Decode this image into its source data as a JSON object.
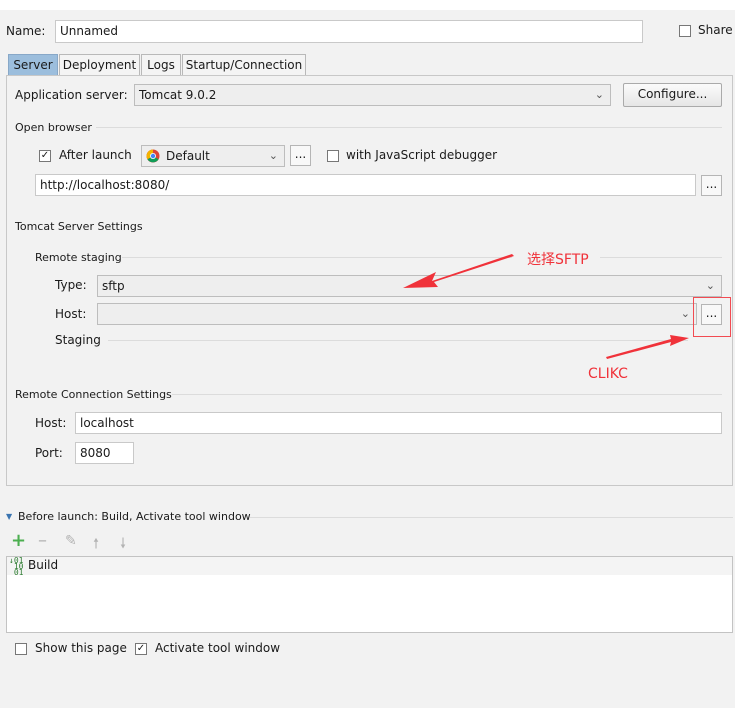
{
  "name": {
    "label": "Name:",
    "value": "Unnamed"
  },
  "share": {
    "label": "Share",
    "checked": false
  },
  "tabs": [
    {
      "label": "Server",
      "active": true
    },
    {
      "label": "Deployment",
      "active": false
    },
    {
      "label": "Logs",
      "active": false
    },
    {
      "label": "Startup/Connection",
      "active": false
    }
  ],
  "app_server": {
    "label": "Application server:",
    "value": "Tomcat 9.0.2",
    "configure_label": "Configure..."
  },
  "open_browser": {
    "section_title": "Open browser",
    "after_launch": {
      "label": "After launch",
      "checked": true
    },
    "browser": "Default",
    "browse_dots": "...",
    "js_debugger": {
      "label": "with JavaScript debugger",
      "checked": false
    },
    "url": "http://localhost:8080/",
    "url_dots": "..."
  },
  "tomcat_settings": {
    "section_title": "Tomcat Server Settings"
  },
  "remote_staging": {
    "section_title": "Remote staging",
    "type": {
      "label": "Type:",
      "value": "sftp"
    },
    "host": {
      "label": "Host:",
      "value": "",
      "dots": "..."
    },
    "staging": {
      "label": "Staging"
    }
  },
  "remote_connection": {
    "section_title": "Remote Connection Settings",
    "host": {
      "label": "Host:",
      "value": "localhost"
    },
    "port": {
      "label": "Port:",
      "value": "8080"
    }
  },
  "before_launch": {
    "title": "Before launch: Build, Activate tool window",
    "tasks": [
      {
        "label": "Build"
      }
    ]
  },
  "footer": {
    "show_page": {
      "label": "Show this page",
      "checked": false
    },
    "activate_window": {
      "label": "Activate tool window",
      "checked": true
    }
  },
  "annotations": {
    "select_sftp": "选择SFTP",
    "click": "CLIKC",
    "color": "#f0323a"
  },
  "colors": {
    "active_tab": "#9cbedd",
    "add_icon": "#4caf50",
    "background": "#f2f2f2"
  }
}
